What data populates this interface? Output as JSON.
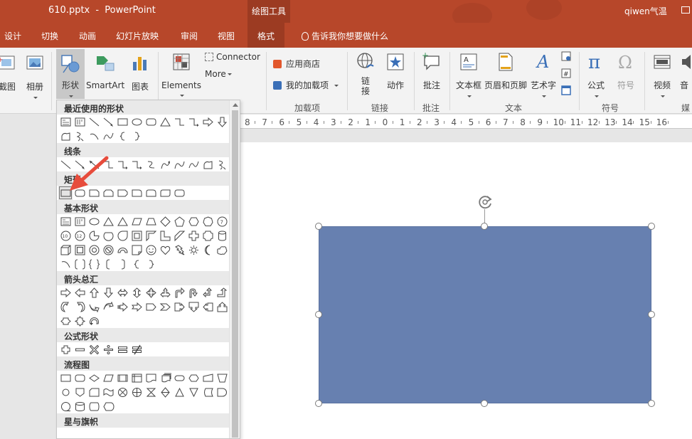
{
  "titlebar": {
    "filename": "610.pptx",
    "separator": "-",
    "app": "PowerPoint",
    "context_tab": "绘图工具",
    "user": "qiwen气温"
  },
  "tabs": [
    {
      "label": "设计",
      "active": false
    },
    {
      "label": "切换",
      "active": false
    },
    {
      "label": "动画",
      "active": false
    },
    {
      "label": "幻灯片放映",
      "active": false
    },
    {
      "label": "审阅",
      "active": false
    },
    {
      "label": "视图",
      "active": false
    },
    {
      "label": "格式",
      "active": true
    }
  ],
  "tellme": "告诉我你想要做什么",
  "ribbon": {
    "buttons": {
      "screenshot": "截图",
      "album": "相册",
      "shapes": "形状",
      "smartart": "SmartArt",
      "chart": "图表",
      "elements": "Elements",
      "connector": "Connector",
      "more": "More",
      "store": "应用商店",
      "myaddins": "我的加载项",
      "link": "链接",
      "action": "动作",
      "comment": "批注",
      "textbox": "文本框",
      "headerfooter": "页眉和页脚",
      "wordart": "艺术字",
      "equation": "公式",
      "symbol": "符号",
      "video": "视频",
      "audio": "音"
    },
    "groups": {
      "addins": "加载项",
      "links": "链接",
      "comments": "批注",
      "text": "文本",
      "symbols": "符号",
      "media": "媒"
    }
  },
  "shapes_gallery": {
    "sections": [
      {
        "title": "最近使用的形状"
      },
      {
        "title": "线条"
      },
      {
        "title": "矩形"
      },
      {
        "title": "基本形状"
      },
      {
        "title": "箭头总汇"
      },
      {
        "title": "公式形状"
      },
      {
        "title": "流程图"
      },
      {
        "title": "星与旗帜"
      }
    ]
  },
  "ruler": {
    "ticks": [
      "8",
      "7",
      "6",
      "5",
      "4",
      "3",
      "2",
      "1",
      "0",
      "1",
      "2",
      "3",
      "4",
      "5",
      "6",
      "7",
      "8",
      "9",
      "10",
      "11",
      "12",
      "13",
      "14",
      "15",
      "16"
    ]
  },
  "colors": {
    "accent": "#b7472a",
    "accent_dark": "#9c3b22",
    "shape_fill": "#6780b0",
    "annotation_arrow": "#e74c3c"
  }
}
